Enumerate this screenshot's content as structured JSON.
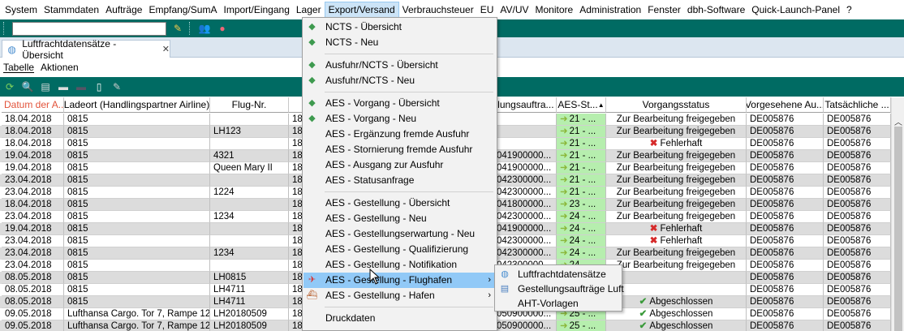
{
  "menubar": [
    "System",
    "Stammdaten",
    "Aufträge",
    "Empfang/SumA",
    "Import/Eingang",
    "Lager",
    "Export/Versand",
    "Verbrauchsteuer",
    "EU",
    "AV/UV",
    "Monitore",
    "Administration",
    "Fenster",
    "dbh-Software",
    "Quick-Launch-Panel",
    "?"
  ],
  "tab": {
    "title": "Luftfrachtdatensätze - Übersicht",
    "close": "✕"
  },
  "subbar": {
    "tabelle": "Tabelle",
    "aktionen": "Aktionen"
  },
  "columns": [
    "Datum der A...",
    "Ladeort (Handlingspartner Airline)",
    "Flug-Nr.",
    "",
    "llungsauftra...",
    "AES-St...",
    "Vorgangsstatus",
    "Vorgesehene Au...",
    "Tatsächliche ..."
  ],
  "rows": [
    {
      "datum": "18.04.2018",
      "ladeort": "0815",
      "flug": "",
      "d": "18",
      "auftrag": "",
      "aes": "21 - ...",
      "status": "Zur Bearbeitung freigegeben",
      "icon": "",
      "vorg": "DE005876",
      "tats": "DE005876"
    },
    {
      "datum": "18.04.2018",
      "ladeort": "0815",
      "flug": "LH123",
      "d": "18",
      "auftrag": "",
      "aes": "21 - ...",
      "status": "Zur Bearbeitung freigegeben",
      "icon": "",
      "vorg": "DE005876",
      "tats": "DE005876"
    },
    {
      "datum": "18.04.2018",
      "ladeort": "0815",
      "flug": "",
      "d": "18",
      "auftrag": "",
      "aes": "21 - ...",
      "status": "Fehlerhaft",
      "icon": "cross",
      "vorg": "DE005876",
      "tats": "DE005876"
    },
    {
      "datum": "19.04.2018",
      "ladeort": "0815",
      "flug": "4321",
      "d": "18",
      "auftrag": "041900000...",
      "aes": "21 - ...",
      "status": "Zur Bearbeitung freigegeben",
      "icon": "",
      "vorg": "DE005876",
      "tats": "DE005876"
    },
    {
      "datum": "19.04.2018",
      "ladeort": "0815",
      "flug": "Queen Mary II",
      "d": "18",
      "auftrag": "041900000...",
      "aes": "21 - ...",
      "status": "Zur Bearbeitung freigegeben",
      "icon": "",
      "vorg": "DE005876",
      "tats": "DE005876"
    },
    {
      "datum": "23.04.2018",
      "ladeort": "0815",
      "flug": "",
      "d": "18",
      "auftrag": "042300000...",
      "aes": "21 - ...",
      "status": "Zur Bearbeitung freigegeben",
      "icon": "",
      "vorg": "DE005876",
      "tats": "DE005876"
    },
    {
      "datum": "23.04.2018",
      "ladeort": "0815",
      "flug": "1224",
      "d": "18",
      "auftrag": "042300000...",
      "aes": "21 - ...",
      "status": "Zur Bearbeitung freigegeben",
      "icon": "",
      "vorg": "DE005876",
      "tats": "DE005876"
    },
    {
      "datum": "18.04.2018",
      "ladeort": "0815",
      "flug": "",
      "d": "18",
      "auftrag": "041800000...",
      "aes": "23 - ...",
      "status": "Zur Bearbeitung freigegeben",
      "icon": "",
      "vorg": "DE005876",
      "tats": "DE005876"
    },
    {
      "datum": "23.04.2018",
      "ladeort": "0815",
      "flug": "1234",
      "d": "18",
      "auftrag": "042300000...",
      "aes": "24 - ...",
      "status": "Zur Bearbeitung freigegeben",
      "icon": "",
      "vorg": "DE005876",
      "tats": "DE005876"
    },
    {
      "datum": "19.04.2018",
      "ladeort": "0815",
      "flug": "",
      "d": "18",
      "auftrag": "041900000...",
      "aes": "24 - ...",
      "status": "Fehlerhaft",
      "icon": "cross",
      "vorg": "DE005876",
      "tats": "DE005876"
    },
    {
      "datum": "23.04.2018",
      "ladeort": "0815",
      "flug": "",
      "d": "18",
      "auftrag": "042300000...",
      "aes": "24 - ...",
      "status": "Fehlerhaft",
      "icon": "cross",
      "vorg": "DE005876",
      "tats": "DE005876"
    },
    {
      "datum": "23.04.2018",
      "ladeort": "0815",
      "flug": "1234",
      "d": "18",
      "auftrag": "042300000...",
      "aes": "24 - ...",
      "status": "Zur Bearbeitung freigegeben",
      "icon": "",
      "vorg": "DE005876",
      "tats": "DE005876"
    },
    {
      "datum": "23.04.2018",
      "ladeort": "0815",
      "flug": "",
      "d": "18",
      "auftrag": "042300000...",
      "aes": "24 - ...",
      "status": "Zur Bearbeitung freigegeben",
      "icon": "",
      "vorg": "DE005876",
      "tats": "DE005876"
    },
    {
      "datum": "08.05.2018",
      "ladeort": "0815",
      "flug": "LH0815",
      "d": "18",
      "auftrag": "",
      "aes": "",
      "status": "",
      "icon": "",
      "vorg": "DE005876",
      "tats": "DE005876"
    },
    {
      "datum": "08.05.2018",
      "ladeort": "0815",
      "flug": "LH4711",
      "d": "18",
      "auftrag": "",
      "aes": "",
      "status": "",
      "icon": "",
      "vorg": "DE005876",
      "tats": "DE005876"
    },
    {
      "datum": "08.05.2018",
      "ladeort": "0815",
      "flug": "LH4711",
      "d": "18",
      "auftrag": "",
      "aes": "",
      "status": "Abgeschlossen",
      "icon": "check",
      "vorg": "DE005876",
      "tats": "DE005876"
    },
    {
      "datum": "09.05.2018",
      "ladeort": "Lufthansa Cargo. Tor 7, Rampe 12",
      "flug": "LH20180509",
      "d": "18",
      "auftrag": "050900000...",
      "aes": "25 - ...",
      "status": "Abgeschlossen",
      "icon": "check",
      "vorg": "DE005876",
      "tats": "DE005876"
    },
    {
      "datum": "09.05.2018",
      "ladeort": "Lufthansa Cargo. Tor 7, Rampe 12",
      "flug": "LH20180509",
      "d": "18",
      "auftrag": "050900000...",
      "aes": "25 - ...",
      "status": "Abgeschlossen",
      "icon": "check",
      "vorg": "DE005876",
      "tats": "DE005876"
    }
  ],
  "menu": [
    {
      "label": "NCTS - Übersicht",
      "icon": "cube"
    },
    {
      "label": "NCTS - Neu",
      "icon": "cube"
    },
    {
      "sep": true
    },
    {
      "label": "Ausfuhr/NCTS - Übersicht",
      "icon": "cube"
    },
    {
      "label": "Ausfuhr/NCTS - Neu",
      "icon": "cube"
    },
    {
      "sep": true
    },
    {
      "label": "AES - Vorgang - Übersicht",
      "icon": "cube"
    },
    {
      "label": "AES - Vorgang - Neu",
      "icon": "cube"
    },
    {
      "label": "AES - Ergänzung fremde Ausfuhr",
      "icon": ""
    },
    {
      "label": "AES - Stornierung fremde Ausfuhr",
      "icon": ""
    },
    {
      "label": "AES - Ausgang zur Ausfuhr",
      "icon": ""
    },
    {
      "label": "AES - Statusanfrage",
      "icon": ""
    },
    {
      "sep": true
    },
    {
      "label": "AES - Gestellung - Übersicht",
      "icon": ""
    },
    {
      "label": "AES - Gestellung - Neu",
      "icon": ""
    },
    {
      "label": "AES - Gestellungserwartung - Neu",
      "icon": ""
    },
    {
      "label": "AES - Gestellung - Qualifizierung",
      "icon": ""
    },
    {
      "label": "AES - Gestellung - Notifikation",
      "icon": ""
    },
    {
      "label": "AES - Gestellung - Flughafen",
      "icon": "plane",
      "sub": true,
      "hl": true
    },
    {
      "label": "AES - Gestellung - Hafen",
      "icon": "ship",
      "sub": true
    },
    {
      "sep": true
    },
    {
      "label": "Druckdaten",
      "icon": ""
    }
  ],
  "submenu": [
    {
      "label": "Luftfrachtdatensätze",
      "icon": "globe"
    },
    {
      "label": "Gestellungsaufträge Luft",
      "icon": "doc"
    },
    {
      "label": "AHT-Vorlagen",
      "icon": ""
    }
  ]
}
